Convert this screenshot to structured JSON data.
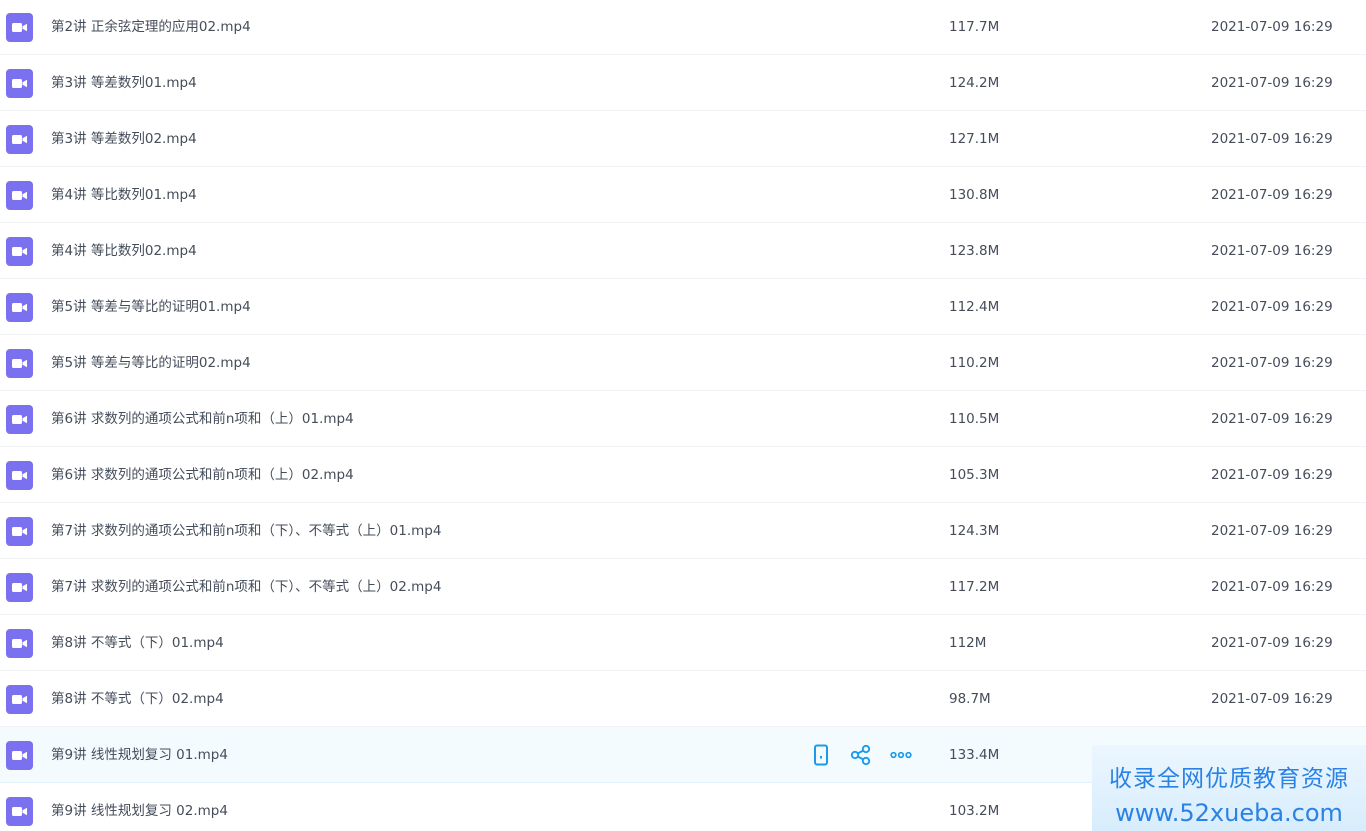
{
  "files": [
    {
      "name": "第2讲 正余弦定理的应用02.mp4",
      "size": "117.7M",
      "date": "2021-07-09 16:29"
    },
    {
      "name": "第3讲 等差数列01.mp4",
      "size": "124.2M",
      "date": "2021-07-09 16:29"
    },
    {
      "name": "第3讲 等差数列02.mp4",
      "size": "127.1M",
      "date": "2021-07-09 16:29"
    },
    {
      "name": "第4讲 等比数列01.mp4",
      "size": "130.8M",
      "date": "2021-07-09 16:29"
    },
    {
      "name": "第4讲 等比数列02.mp4",
      "size": "123.8M",
      "date": "2021-07-09 16:29"
    },
    {
      "name": "第5讲 等差与等比的证明01.mp4",
      "size": "112.4M",
      "date": "2021-07-09 16:29"
    },
    {
      "name": "第5讲 等差与等比的证明02.mp4",
      "size": "110.2M",
      "date": "2021-07-09 16:29"
    },
    {
      "name": "第6讲 求数列的通项公式和前n项和（上）01.mp4",
      "size": "110.5M",
      "date": "2021-07-09 16:29"
    },
    {
      "name": "第6讲 求数列的通项公式和前n项和（上）02.mp4",
      "size": "105.3M",
      "date": "2021-07-09 16:29"
    },
    {
      "name": "第7讲 求数列的通项公式和前n项和（下）、不等式（上）01.mp4",
      "size": "124.3M",
      "date": "2021-07-09 16:29"
    },
    {
      "name": "第7讲 求数列的通项公式和前n项和（下）、不等式（上）02.mp4",
      "size": "117.2M",
      "date": "2021-07-09 16:29"
    },
    {
      "name": "第8讲 不等式（下）01.mp4",
      "size": "112M",
      "date": "2021-07-09 16:29"
    },
    {
      "name": "第8讲 不等式（下）02.mp4",
      "size": "98.7M",
      "date": "2021-07-09 16:29"
    },
    {
      "name": "第9讲 线性规划复习 01.mp4",
      "size": "133.4M",
      "date": ""
    },
    {
      "name": "第9讲 线性规划复习 02.mp4",
      "size": "103.2M",
      "date": ""
    }
  ],
  "hovered_row_index": 13,
  "row_actions": [
    {
      "icon": "phone-icon"
    },
    {
      "icon": "share-icon"
    },
    {
      "icon": "more-icon"
    }
  ],
  "watermark": {
    "line1": "收录全网优质教育资源",
    "line2": "www.52xueba.com"
  },
  "colors": {
    "video_icon": "#7b70ef",
    "action_icon": "#1a9bea",
    "text": "#454d5a",
    "hover_row": "#f4fbff",
    "watermark_text": "#2a82e4"
  }
}
